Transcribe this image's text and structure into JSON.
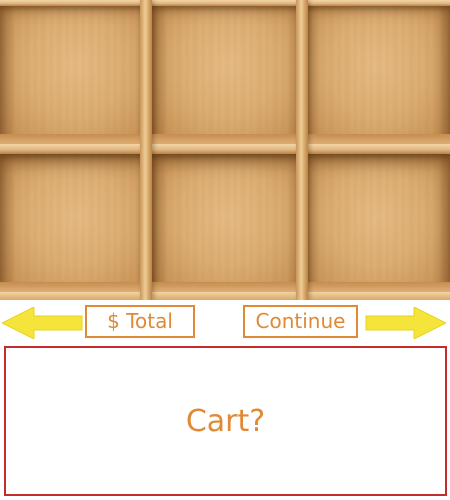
{
  "nav": {
    "total_label": "$ Total",
    "continue_label": "Continue"
  },
  "cart": {
    "label": "Cart?"
  },
  "colors": {
    "accent": "#e08a36",
    "arrow_fill": "#f5e43a",
    "cart_border": "#c62b2b"
  },
  "icons": {
    "left_arrow": "arrow-left-icon",
    "right_arrow": "arrow-right-icon"
  }
}
